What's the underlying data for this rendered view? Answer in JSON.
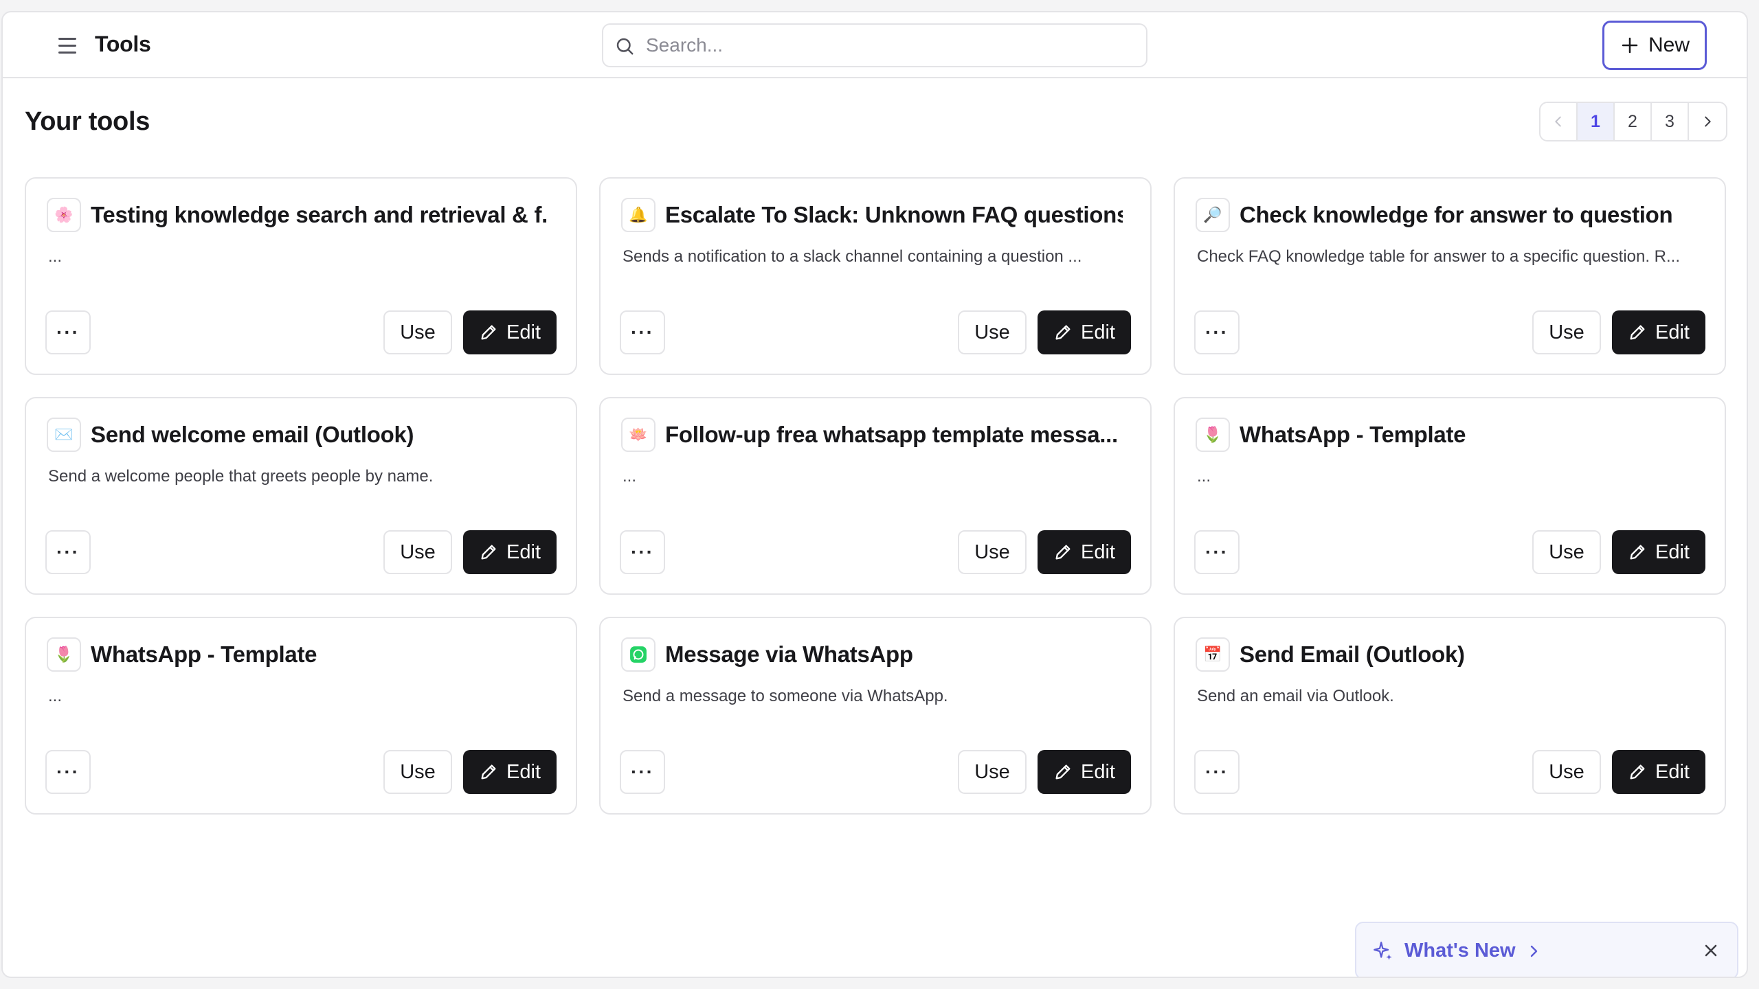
{
  "header": {
    "title": "Tools",
    "search_placeholder": "Search...",
    "new_label": "New"
  },
  "section": {
    "title": "Your tools"
  },
  "pagination": {
    "pages": [
      "1",
      "2",
      "3"
    ],
    "current": "1"
  },
  "tools": [
    {
      "title": "Testing knowledge search and retrieval & f...",
      "description": "...",
      "icon": "flower-icon",
      "glyph": "🌸"
    },
    {
      "title": "Escalate To Slack: Unknown FAQ questions",
      "description": "Sends a notification to a slack channel containing a question ...",
      "icon": "bell-icon",
      "glyph": "🔔"
    },
    {
      "title": "Check knowledge for answer to question",
      "description": "Check FAQ knowledge table for answer to a specific question. R...",
      "icon": "magnifier-icon",
      "glyph": "🔎"
    },
    {
      "title": "Send welcome email (Outlook)",
      "description": "Send a welcome people that greets people by name.",
      "icon": "envelope-icon",
      "glyph": "✉️"
    },
    {
      "title": "Follow-up frea whatsapp template messa...",
      "description": "...",
      "icon": "lotus-icon",
      "glyph": "🪷"
    },
    {
      "title": "WhatsApp - Template",
      "description": "...",
      "icon": "tulip-icon",
      "glyph": "🌷"
    },
    {
      "title": "WhatsApp - Template",
      "description": "...",
      "icon": "tulip-icon",
      "glyph": "🌷"
    },
    {
      "title": "Message via WhatsApp",
      "description": "Send a message to someone via WhatsApp.",
      "icon": "whatsapp-icon",
      "glyph": ""
    },
    {
      "title": "Send Email (Outlook)",
      "description": "Send an email via Outlook.",
      "icon": "calendar-icon",
      "glyph": "📅"
    }
  ],
  "card_actions": {
    "more_label": "···",
    "use_label": "Use",
    "edit_label": "Edit"
  },
  "toast": {
    "label": "What's New"
  },
  "colors": {
    "accent": "#5b5bd6",
    "primary_button": "#18181b",
    "border": "#e4e4e7",
    "whatsapp_green": "#25d366"
  }
}
